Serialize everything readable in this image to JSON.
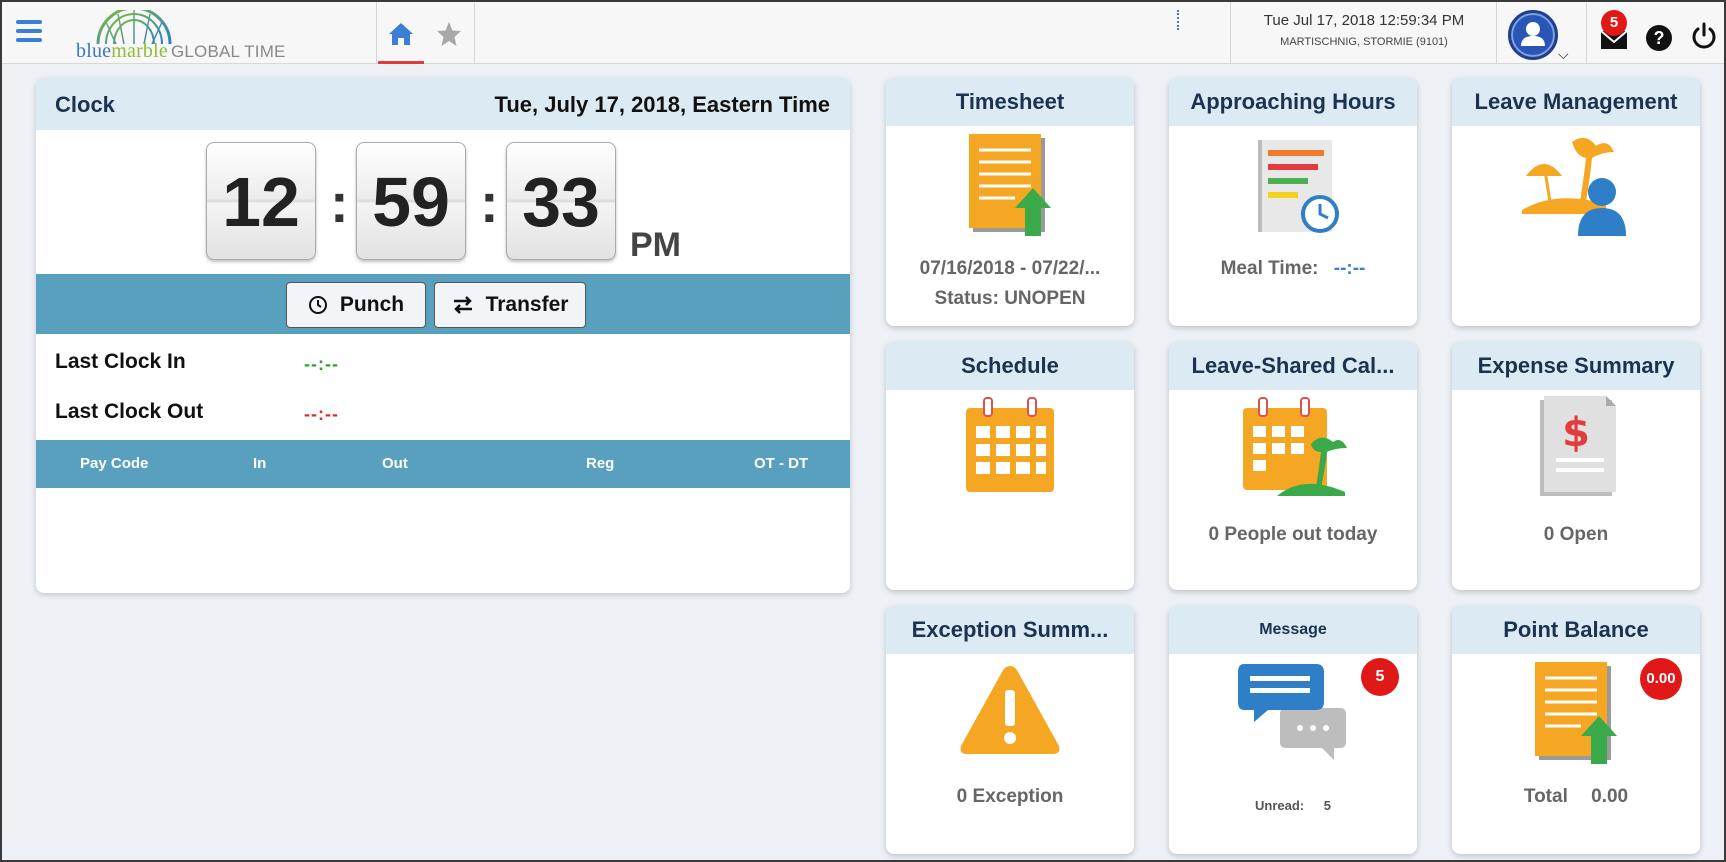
{
  "header": {
    "logo": {
      "part1": "blue",
      "part2": "marble",
      "part3": "GLOBAL TIME"
    },
    "datetime": "Tue Jul 17, 2018 12:59:34 PM",
    "user": "MARTISCHNIG, STORMIE (9101)",
    "mail_count": "5",
    "help_glyph": "?"
  },
  "clock": {
    "title": "Clock",
    "date": "Tue, July 17, 2018, Eastern Time",
    "hours": "12",
    "minutes": "59",
    "seconds": "33",
    "sep1": ":",
    "sep2": ":",
    "ampm": "PM",
    "punch_label": "Punch",
    "transfer_label": "Transfer",
    "last_in_label": "Last Clock In",
    "last_in_value": "--:--",
    "last_out_label": "Last Clock Out",
    "last_out_value": "--:--",
    "columns": [
      "Pay Code",
      "In",
      "Out",
      "Reg",
      "OT - DT"
    ]
  },
  "tiles": {
    "timesheet": {
      "title": "Timesheet",
      "line1": "07/16/2018 - 07/22/...",
      "line2": "Status: UNOPEN"
    },
    "approaching": {
      "title": "Approaching Hours",
      "label": "Meal Time:",
      "value": "--:--"
    },
    "leave": {
      "title": "Leave Management"
    },
    "schedule": {
      "title": "Schedule"
    },
    "leave_shared": {
      "title": "Leave-Shared Cal...",
      "line1": "0 People out today"
    },
    "expense": {
      "title": "Expense Summary",
      "line1": "0 Open"
    },
    "exception": {
      "title": "Exception Summ...",
      "line1": "0 Exception"
    },
    "message": {
      "title": "Message",
      "badge": "5",
      "unread_label": "Unread:",
      "unread_value": "5"
    },
    "points": {
      "title": "Point Balance",
      "badge": "0.00",
      "total_label": "Total",
      "total_value": "0.00"
    }
  },
  "colors": {
    "accent": "#58a0be",
    "header_bg": "#dcebf3",
    "clock_in": "#2ea02e",
    "clock_out": "#e02a2a",
    "badge": "#e01818"
  },
  "icons": [
    "menu-icon",
    "home-icon",
    "star-icon",
    "avatar-icon",
    "mail-icon",
    "help-icon",
    "power-icon",
    "clock-icon",
    "transfer-icon"
  ]
}
